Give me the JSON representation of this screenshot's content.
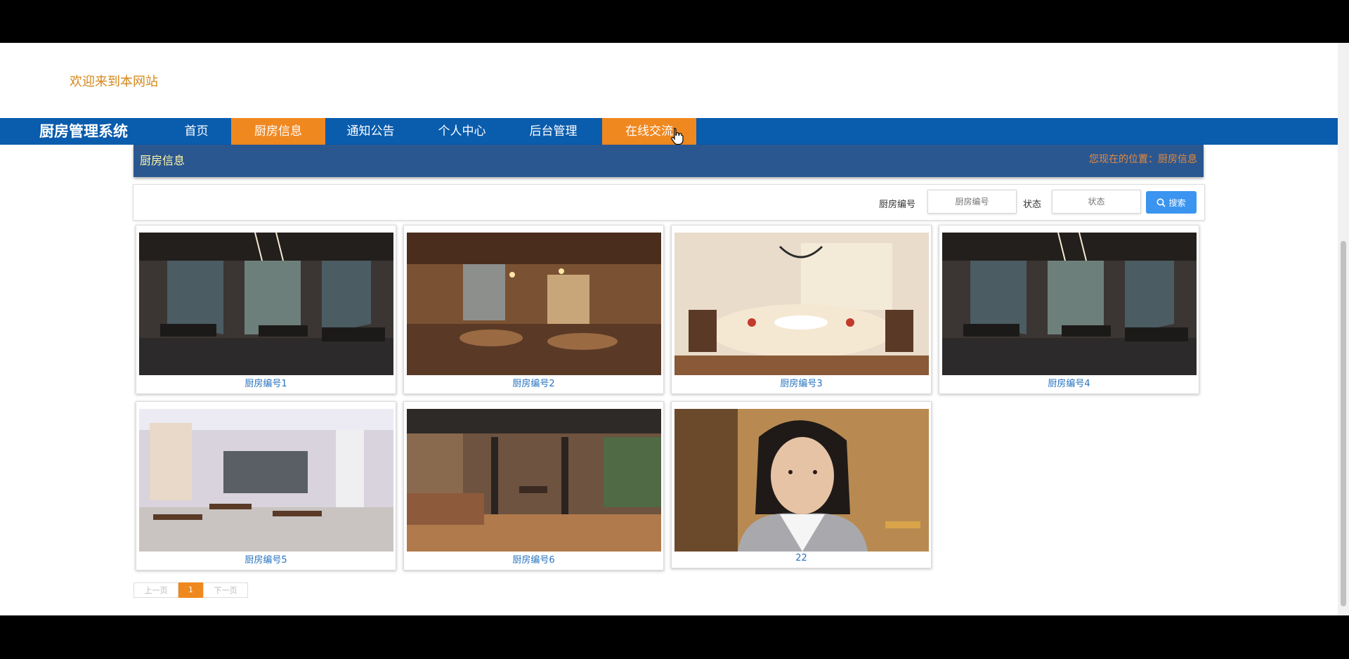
{
  "welcome_text": "欢迎来到本网站",
  "brand": "厨房管理系统",
  "nav": {
    "items": [
      {
        "label": "首页"
      },
      {
        "label": "厨房信息"
      },
      {
        "label": "通知公告"
      },
      {
        "label": "个人中心"
      },
      {
        "label": "后台管理"
      },
      {
        "label": "在线交流"
      }
    ],
    "active": "厨房信息",
    "hovered": "在线交流"
  },
  "breadcrumb": {
    "title": "厨房信息",
    "location": "您现在的位置：厨房信息"
  },
  "search": {
    "kitchen_no_label": "厨房编号",
    "kitchen_no_placeholder": "厨房编号",
    "status_label": "状态",
    "status_placeholder": "状态",
    "button_label": "搜索"
  },
  "cards": [
    {
      "caption": "厨房编号1",
      "image": "restaurant-dark-interior"
    },
    {
      "caption": "厨房编号2",
      "image": "restaurant-wood-interior"
    },
    {
      "caption": "厨房编号3",
      "image": "round-banquet-table"
    },
    {
      "caption": "厨房编号4",
      "image": "restaurant-dark-interior"
    },
    {
      "caption": "厨房编号5",
      "image": "canteen-dining-hall"
    },
    {
      "caption": "厨房编号6",
      "image": "restaurant-herringbone-floor"
    },
    {
      "caption": "22",
      "image": "woman-portrait"
    }
  ],
  "pagination": {
    "prev": "上一页",
    "current": "1",
    "next": "下一页"
  },
  "colors": {
    "navbar": "#0a5cad",
    "active_tab": "#f08820",
    "breadcrumb_bar": "#2b5790",
    "search_button": "#3a94f0",
    "caption": "#2874c0"
  }
}
